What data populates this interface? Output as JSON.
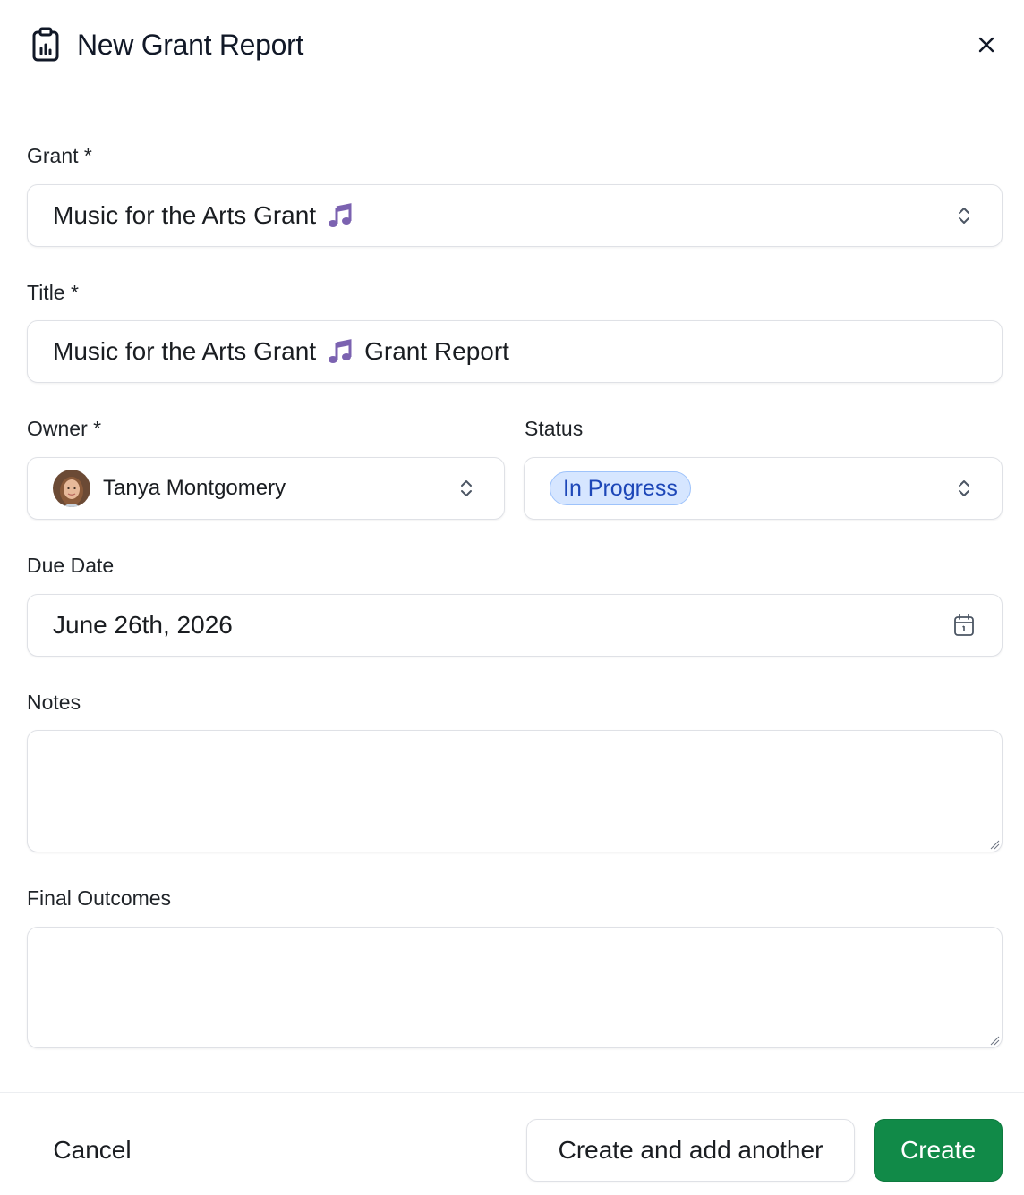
{
  "dialog": {
    "title": "New Grant Report",
    "icon": "clipboard-chart-icon",
    "close_icon": "close-icon"
  },
  "form": {
    "grant": {
      "label": "Grant *",
      "value": "Music for the Arts Grant",
      "emoji": "music-note-icon"
    },
    "title": {
      "label": "Title *",
      "value_before": "Music for the Arts Grant",
      "emoji": "music-note-icon",
      "value_after": "Grant Report"
    },
    "owner": {
      "label": "Owner *",
      "value": "Tanya Montgomery"
    },
    "status": {
      "label": "Status",
      "value": "In Progress"
    },
    "due_date": {
      "label": "Due Date",
      "value": "June 26th, 2026",
      "icon": "calendar-icon"
    },
    "notes": {
      "label": "Notes",
      "value": ""
    },
    "final_outcomes": {
      "label": "Final Outcomes",
      "value": ""
    }
  },
  "footer": {
    "cancel_label": "Cancel",
    "create_another_label": "Create and add another",
    "create_label": "Create"
  },
  "colors": {
    "primary": "#118a48",
    "status_bg": "#d6e6ff",
    "status_text": "#1d47b8",
    "music_note": "#7b62b0"
  }
}
